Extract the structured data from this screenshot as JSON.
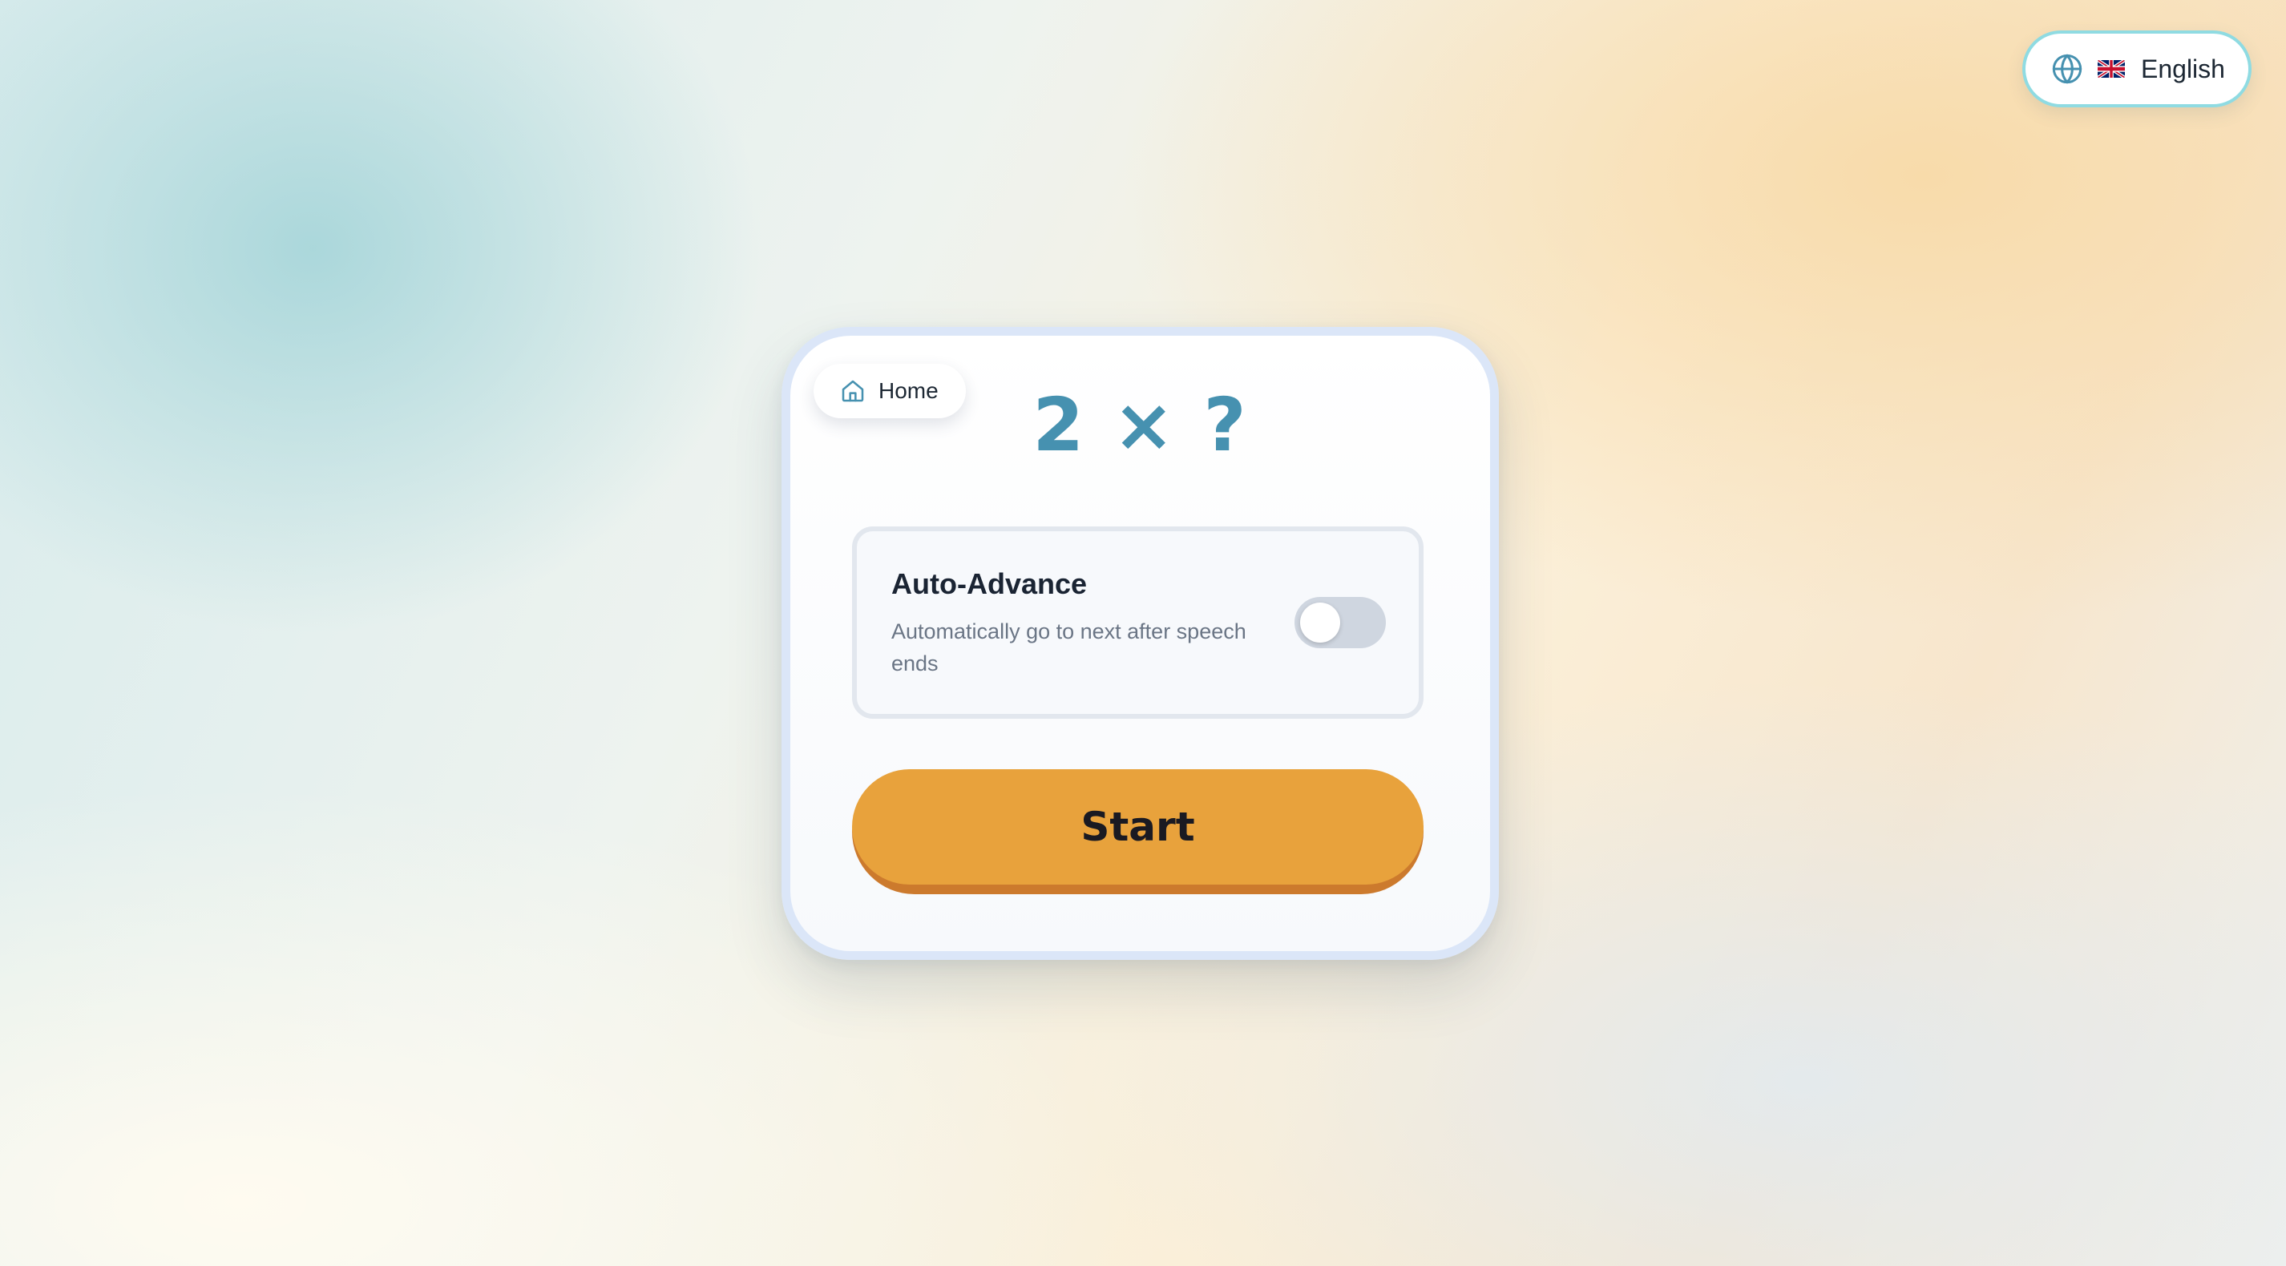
{
  "language_selector": {
    "icon": "globe-icon",
    "flag": "uk-flag-icon",
    "label": "English"
  },
  "home_button": {
    "icon": "home-icon",
    "label": "Home"
  },
  "equation": "2 × ?",
  "auto_advance": {
    "title": "Auto-Advance",
    "description": "Automatically go to next after speech ends",
    "enabled": false
  },
  "start_button": {
    "label": "Start"
  },
  "colors": {
    "accent_blue": "#4691b0",
    "start_orange": "#e8a23c",
    "start_shadow": "#cc7a2d",
    "language_border": "#8fdbe2",
    "toggle_off": "#cfd6e0"
  }
}
